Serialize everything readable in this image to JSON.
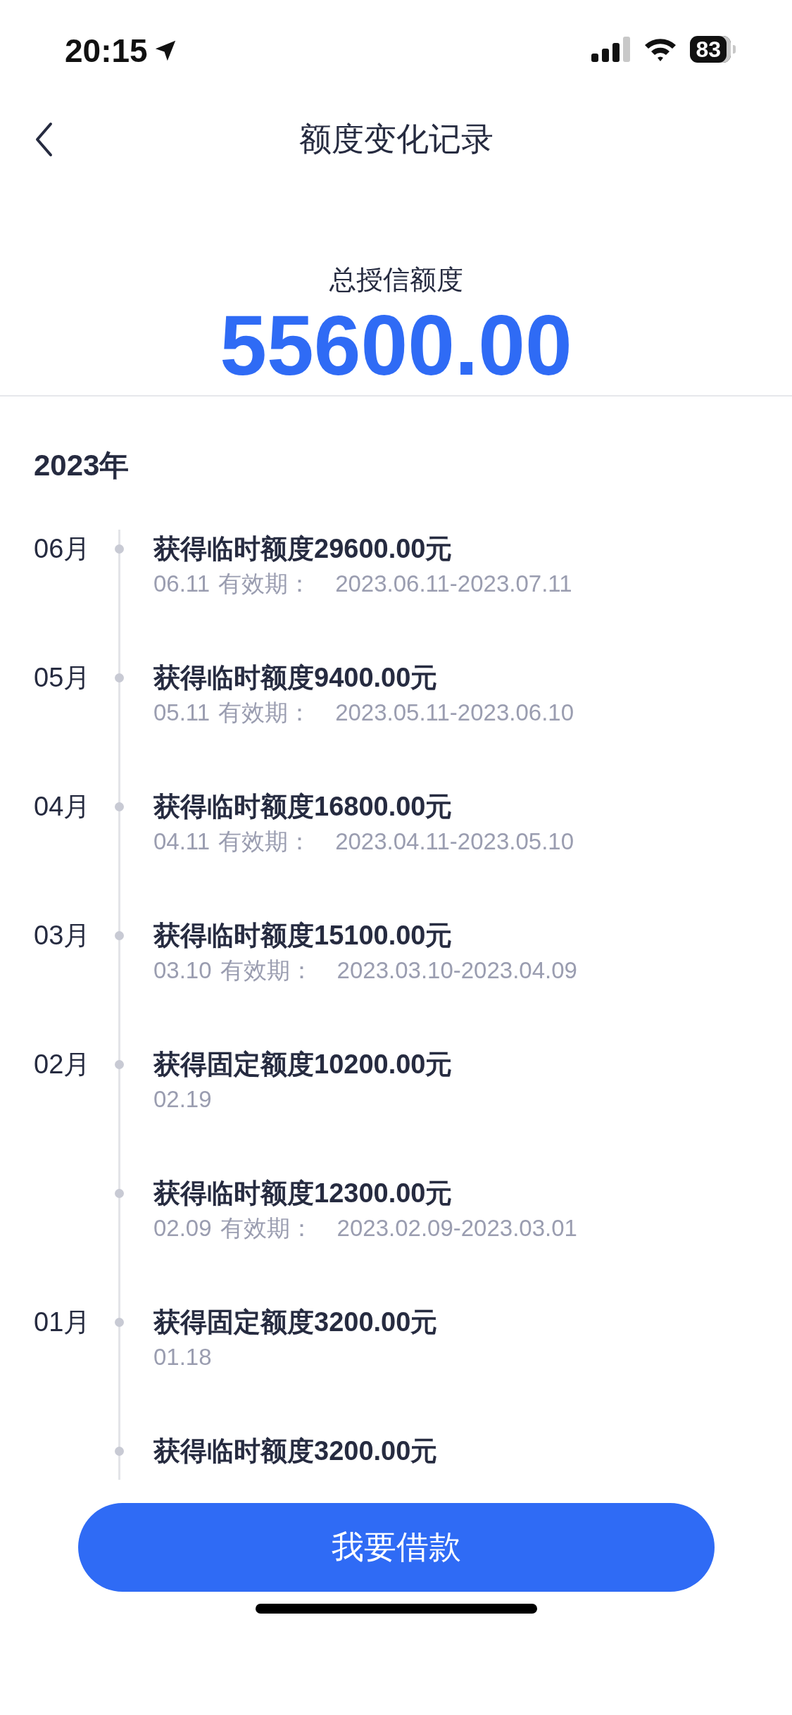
{
  "status_bar": {
    "time": "20:15",
    "battery": "83"
  },
  "nav": {
    "title": "额度变化记录"
  },
  "summary": {
    "label": "总授信额度",
    "amount": "55600.00"
  },
  "year": "2023年",
  "records": [
    {
      "month": "06月",
      "title": "获得临时额度29600.00元",
      "date": "06.11",
      "validity_label": "有效期：",
      "validity": "2023.06.11-2023.07.11"
    },
    {
      "month": "05月",
      "title": "获得临时额度9400.00元",
      "date": "05.11",
      "validity_label": "有效期：",
      "validity": "2023.05.11-2023.06.10"
    },
    {
      "month": "04月",
      "title": "获得临时额度16800.00元",
      "date": "04.11",
      "validity_label": "有效期：",
      "validity": "2023.04.11-2023.05.10"
    },
    {
      "month": "03月",
      "title": "获得临时额度15100.00元",
      "date": "03.10",
      "validity_label": "有效期：",
      "validity": "2023.03.10-2023.04.09"
    },
    {
      "month": "02月",
      "title": "获得固定额度10200.00元",
      "date": "02.19"
    },
    {
      "title": "获得临时额度12300.00元",
      "date": "02.09",
      "validity_label": "有效期：",
      "validity": "2023.02.09-2023.03.01"
    },
    {
      "month": "01月",
      "title": "获得固定额度3200.00元",
      "date": "01.18"
    },
    {
      "title": "获得临时额度3200.00元"
    }
  ],
  "button": "我要借款"
}
